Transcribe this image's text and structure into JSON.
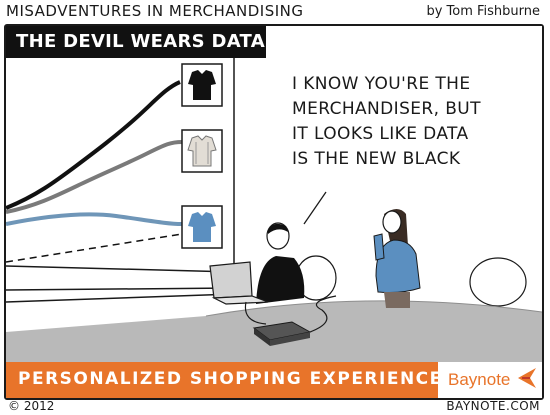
{
  "header": {
    "series_title": "MISADVENTURES IN MERCHANDISING",
    "byline": "by Tom Fishburne"
  },
  "cartoon": {
    "title": "THE DEVIL WEARS DATA",
    "speech_lines": [
      "I KNOW YOU'RE THE",
      "MERCHANDISER, BUT",
      "IT LOOKS LIKE DATA",
      "IS THE NEW BLACK"
    ]
  },
  "footer": {
    "tagline": "PERSONALIZED SHOPPING EXPERIENCES",
    "brand": "Baynote",
    "copyright": "© 2012",
    "website": "BAYNOTE.COM"
  },
  "colors": {
    "accent": "#e8742a",
    "banner": "#111111",
    "line_black": "#111111",
    "line_gray": "#7a7a7a",
    "line_blue": "#6f96b8",
    "shirt_blue": "#5b8fc0",
    "table": "#b9b9b9"
  },
  "icons": [
    "black-garment-icon",
    "gray-garment-icon",
    "blue-garment-icon",
    "baynote-logo-icon"
  ]
}
